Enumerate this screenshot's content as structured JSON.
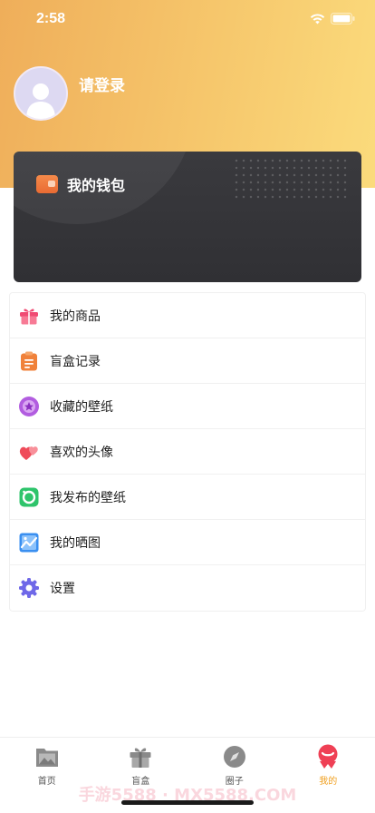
{
  "status_bar": {
    "time": "2:58"
  },
  "profile": {
    "login_text": "请登录",
    "avatar_icon": "user-silhouette-icon"
  },
  "wallet": {
    "label": "我的钱包",
    "icon": "wallet-icon"
  },
  "menu": {
    "items": [
      {
        "label": "我的商品",
        "icon": "gift-icon",
        "color": "#f04b73"
      },
      {
        "label": "盲盒记录",
        "icon": "clipboard-icon",
        "color": "#f0813a"
      },
      {
        "label": "收藏的壁纸",
        "icon": "star-circle-icon",
        "color": "#a64ad9"
      },
      {
        "label": "喜欢的头像",
        "icon": "hearts-icon",
        "color": "#ef4b5a"
      },
      {
        "label": "我发布的壁纸",
        "icon": "photo-frame-icon",
        "color": "#2ec46b"
      },
      {
        "label": "我的晒图",
        "icon": "image-chart-icon",
        "color": "#3a8ff0"
      },
      {
        "label": "设置",
        "icon": "gear-icon",
        "color": "#6f68e8"
      }
    ]
  },
  "tab_bar": {
    "tabs": [
      {
        "label": "首页",
        "icon": "picture-icon",
        "active": false
      },
      {
        "label": "盲盒",
        "icon": "gift-box-icon",
        "active": false
      },
      {
        "label": "圈子",
        "icon": "compass-icon",
        "active": false
      },
      {
        "label": "我的",
        "icon": "profile-badge-icon",
        "active": true
      }
    ]
  },
  "watermark": "手游5588 · MX5588.COM",
  "colors": {
    "accent": "#f0a020",
    "header_start": "#efae5a",
    "header_end": "#fbdb7c",
    "card": "#353539"
  }
}
